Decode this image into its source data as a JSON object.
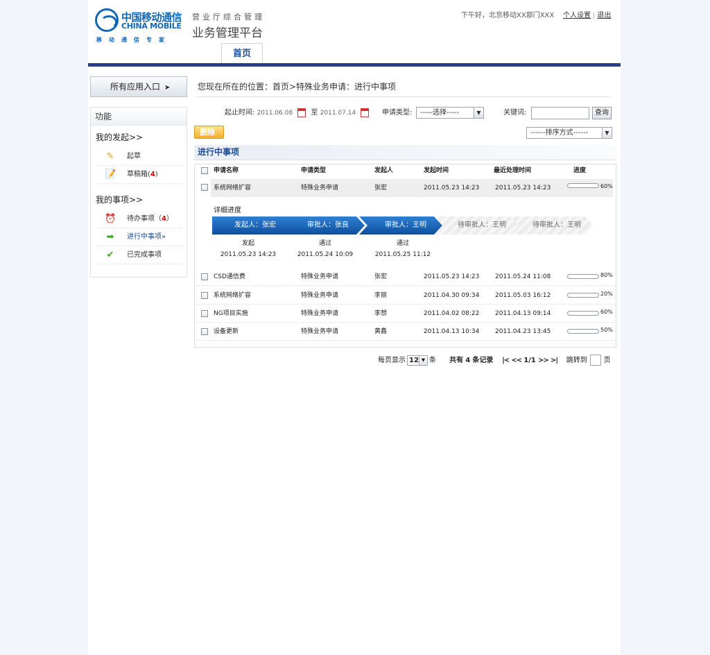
{
  "header": {
    "logo_cn": "中国移动通信",
    "logo_en": "CHINA MOBILE",
    "logo_slogan": "移动通信专家",
    "app_subtitle": "营业厅综合管理",
    "app_title": "业务管理平台",
    "greeting": "下午好，北京移动XX部门XXX",
    "settings_link": "个人设置",
    "separator": "|",
    "logout_link": "退出",
    "nav_home": "首页",
    "brand_color": "#2a3d8f"
  },
  "sidebar": {
    "all_apps_label": "所有应用入口",
    "all_apps_arrow": "➤",
    "section_title": "功能",
    "group_mine": "我的发起>>",
    "draft": "起草",
    "drafts_box": "草稿箱",
    "drafts_count": "4",
    "group_tasks": "我的事项>>",
    "pending": "待办事项",
    "pending_count": "4",
    "in_progress": "进行中事项",
    "in_progress_mark": "»",
    "completed": "已完成事项"
  },
  "main": {
    "location": "您现在所在的位置：首页>特殊业务申请：进行中事项",
    "filter": {
      "date_label": "起止时间:",
      "date_from": "2011.06.08",
      "to_label": "至",
      "date_to": "2011.07.14",
      "type_label": "申请类型:",
      "type_selected": "-----选择-----",
      "keyword_label": "关键词:",
      "keyword_value": "",
      "search_button": "查询",
      "sort_selected": "------排序方式------"
    },
    "delete_button": "删除",
    "section_title": "进行中事项",
    "table": {
      "headers": [
        "申请名称",
        "申请类型",
        "发起人",
        "发起时间",
        "最近处理时间",
        "进度"
      ],
      "rows": [
        {
          "name": "系统网络扩容",
          "type": "特殊业务申请",
          "initiator": "张宏",
          "start": "2011.05.23 14:23",
          "last": "2011.05.23 14:23",
          "progress": 60,
          "progress_text": "60%"
        },
        {
          "name": "CSD通信费",
          "type": "特殊业务申请",
          "initiator": "张宏",
          "start": "2011.05.23 14:23",
          "last": "2011.05.24 11:08",
          "progress": 80,
          "progress_text": "80%"
        },
        {
          "name": "系统网络扩容",
          "type": "特殊业务申请",
          "initiator": "李丽",
          "start": "2011.04.30 09:34",
          "last": "2011.05.03 16:12",
          "progress": 20,
          "progress_text": "20%"
        },
        {
          "name": "NG项目实施",
          "type": "特殊业务申请",
          "initiator": "李想",
          "start": "2011.04.02 08:22",
          "last": "2011.04.13 09:14",
          "progress": 60,
          "progress_text": "60%"
        },
        {
          "name": "设备更新",
          "type": "特殊业务申请",
          "initiator": "黄鑫",
          "start": "2011.04.13 10:34",
          "last": "2011.04.23 13:45",
          "progress": 50,
          "progress_text": "50%"
        }
      ]
    },
    "detail": {
      "title": "详细进度",
      "steps": [
        {
          "label": "发起人：张宏",
          "status": "发起",
          "time": "2011.05.23 14:23"
        },
        {
          "label": "审批人：张良",
          "status": "通过",
          "time": "2011.05.24 10:09"
        },
        {
          "label": "审批人：王明",
          "status": "通过",
          "time": "2011.05.25 11:12"
        },
        {
          "label": "待审批人：王明"
        },
        {
          "label": "待审批人：王明"
        }
      ]
    },
    "pager": {
      "per_page_label": "每页显示",
      "per_page_value": "12",
      "per_page_unit": "条",
      "total_prefix": "共有",
      "total_count": "4",
      "total_suffix": "条记录",
      "first": "|<",
      "prev": "<<",
      "page_info": "1/1",
      "next": ">>",
      "last": ">|",
      "jump_label": "跳转到",
      "page_unit": "页"
    }
  }
}
